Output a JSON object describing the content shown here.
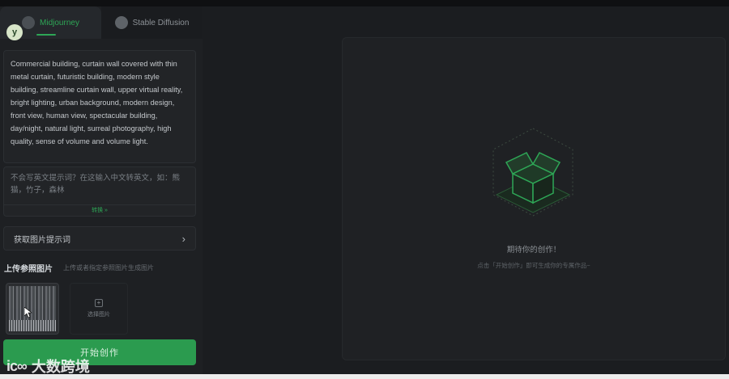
{
  "tabs": [
    {
      "label": "Midjourney",
      "active": true
    },
    {
      "label": "Stable Diffusion",
      "active": false
    }
  ],
  "brand_badge": "y",
  "prompt": {
    "text": "Commercial building, curtain wall covered with thin metal curtain, futuristic building, modern style building, streamline curtain wall, upper virtual reality, bright lighting, urban background, modern design, front view, human view, spectacular building, day/night, natural light, surreal photography, high quality, sense of volume and volume light."
  },
  "translate": {
    "placeholder": "不会写英文提示词？在这输入中文转英文，如：熊猫，竹子，森林",
    "button_label": "转换 »"
  },
  "get_image_prompt": {
    "label": "获取图片提示词"
  },
  "upload": {
    "title": "上传参照图片",
    "hint": "上传或者指定参照图片生成图片",
    "add_label": "选择图片"
  },
  "start_button": "开始创作",
  "watermark": {
    "logo": "ic∞",
    "text": "大数跨境"
  },
  "canvas": {
    "empty_title": "期待你的创作！",
    "empty_subtitle": "点击「开始创作」即可生成你的专属作品~"
  },
  "colors": {
    "accent": "#2ea656",
    "background": "#1b1d20"
  }
}
